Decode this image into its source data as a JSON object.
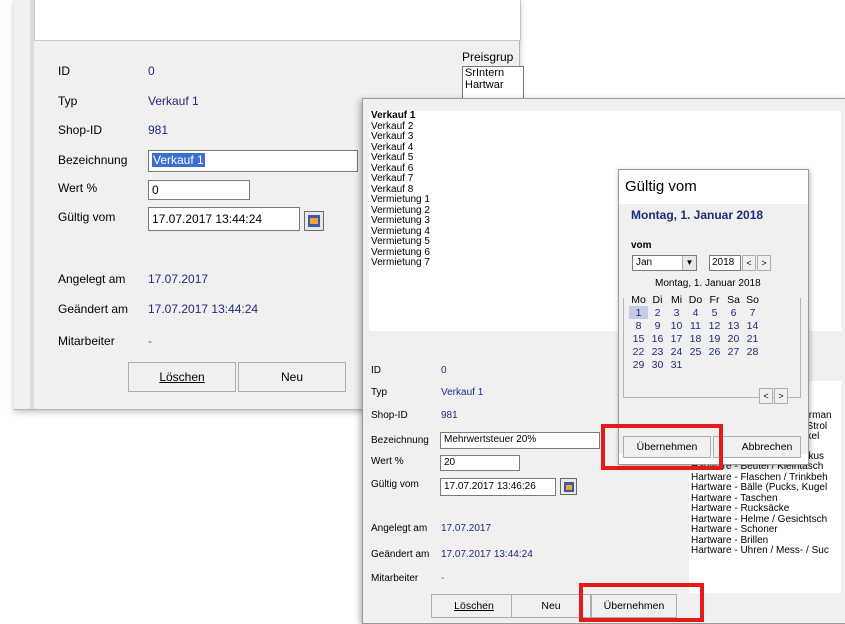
{
  "back_window": {
    "labels": {
      "id": "ID",
      "typ": "Typ",
      "shop_id": "Shop-ID",
      "bezeichnung": "Bezeichnung",
      "wert": "Wert %",
      "gueltig": "Gültig vom",
      "angelegt": "Angelegt am",
      "geaendert": "Geändert am",
      "mitarbeiter": "Mitarbeiter"
    },
    "values": {
      "id": "0",
      "typ": "Verkauf 1",
      "shop_id": "981",
      "bezeichnung": "Verkauf 1",
      "wert": "0",
      "gueltig": "17.07.2017 13:44:24",
      "angelegt": "17.07.2017",
      "geaendert": "17.07.2017 13:44:24",
      "mitarbeiter": "-"
    },
    "preisgruppe_label": "Preisgrup",
    "preisgruppe_items": [
      "SrIntern",
      "Hartwar"
    ],
    "buttons": {
      "loeschen": "Löschen",
      "neu": "Neu"
    }
  },
  "front_window": {
    "type_list": [
      "Verkauf 1",
      "Verkauf 2",
      "Verkauf 3",
      "Verkauf 4",
      "Verkauf 5",
      "Verkauf 6",
      "Verkauf 7",
      "Verkauf 8",
      "Vermietung 1",
      "Vermietung 2",
      "Vermietung 3",
      "Vermietung 4",
      "Vermietung 5",
      "Vermietung 6",
      "Vermietung 7"
    ],
    "labels": {
      "id": "ID",
      "typ": "Typ",
      "shop_id": "Shop-ID",
      "bezeichnung": "Bezeichnung",
      "wert": "Wert %",
      "gueltig": "Gültig vom",
      "angelegt": "Angelegt am",
      "geaendert": "Geändert am",
      "mitarbeiter": "Mitarbeiter"
    },
    "values": {
      "id": "0",
      "typ": "Verkauf 1",
      "shop_id": "981",
      "bezeichnung": "Mehrwertsteuer 20%",
      "wert": "20",
      "gueltig": "17.07.2017 13:46:26",
      "angelegt": "17.07.2017",
      "geaendert": "17.07.2017 13:44:24",
      "mitarbeiter": "-"
    },
    "buttons": {
      "loeschen": "Löschen",
      "neu": "Neu",
      "uebernehmen": "Übernehmen"
    },
    "right_list": [
      "Hartware - Beutel / Kleintasch",
      "Hartware - Flaschen / Trinkbeh",
      "Hartware - Bälle (Pucks, Kugel",
      "Hartware - Taschen",
      "Hartware - Rucksäcke",
      "Hartware - Helme / Gesichtsch",
      "Hartware - Schoner",
      "Hartware - Brillen",
      "Hartware - Uhren / Mess- / Suc"
    ],
    "right_list_partial": [
      "larman",
      "/ Strol",
      "nkel",
      "Batterien / Akkus"
    ]
  },
  "calendar_popup": {
    "title": "Gültig vom",
    "date_heading": "Montag, 1. Januar 2018",
    "vom_label": "vom",
    "month": "Jan",
    "year": "2018",
    "subheading": "Montag, 1. Januar 2018",
    "weekdays": [
      "Mo",
      "Di",
      "Mi",
      "Do",
      "Fr",
      "Sa",
      "So"
    ],
    "weeks": [
      [
        "1",
        "2",
        "3",
        "4",
        "5",
        "6",
        "7"
      ],
      [
        "8",
        "9",
        "10",
        "11",
        "12",
        "13",
        "14"
      ],
      [
        "15",
        "16",
        "17",
        "18",
        "19",
        "20",
        "21"
      ],
      [
        "22",
        "23",
        "24",
        "25",
        "26",
        "27",
        "28"
      ],
      [
        "29",
        "30",
        "31",
        "",
        "",
        "",
        ""
      ]
    ],
    "selected_day": "1",
    "nav_prev": "<",
    "nav_next": ">",
    "buttons": {
      "uebernehmen": "Übernehmen",
      "abbrechen": "Abbrechen"
    }
  }
}
